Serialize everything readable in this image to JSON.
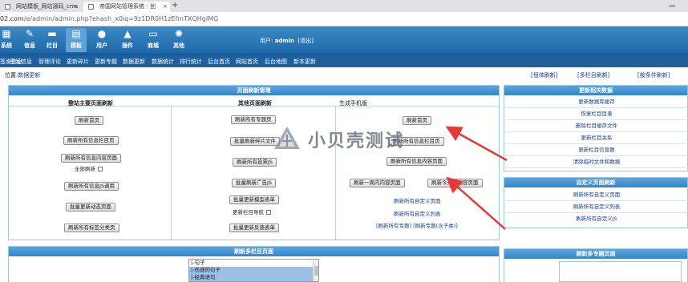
{
  "browser": {
    "tabs": [
      {
        "title": "网站模板_网站源码_cms",
        "active": false
      },
      {
        "title": "帝国网站管理系统 - 创",
        "active": true
      }
    ],
    "url_host": "02.com",
    "url_path": "/e/admin/admin.php?ehash_x0iq=9z1DR0H1zEfmTXQHgIMG"
  },
  "topnav": {
    "items": [
      {
        "label": "系统",
        "icon": "system-icon"
      },
      {
        "label": "信息",
        "icon": "info-icon"
      },
      {
        "label": "栏目",
        "icon": "folder-icon"
      },
      {
        "label": "模板",
        "icon": "template-icon",
        "active": true
      },
      {
        "label": "用户",
        "icon": "user-icon"
      },
      {
        "label": "插件",
        "icon": "plugin-icon"
      },
      {
        "label": "商城",
        "icon": "shop-icon"
      },
      {
        "label": "其他",
        "icon": "gear-icon"
      }
    ],
    "user_prefix": "用户:",
    "username": "admin",
    "logout": "[退出]"
  },
  "submenu": [
    "签发信息",
    "管理评论",
    "数据更新",
    "更新碎片",
    "更新专题",
    "数据更新",
    "数据统计",
    "排行统计",
    "后台首页",
    "网站首页",
    "后台地图",
    "新本更新"
  ],
  "location": {
    "prefix": "位置:",
    "link": "数据更新"
  },
  "toplinks": [
    "[恒体刷新]",
    "[多栏目刷新]",
    "[按条件刷新]"
  ],
  "main_panel": {
    "title": "页面刷新管理",
    "col_headers": [
      "整站主要页面刷新",
      "其他页面刷新",
      "生成手机版"
    ],
    "col1": [
      "刷新首页",
      "刷新所有信息栏目页",
      "刷新所有信息内容页面",
      "刷新所有信息JS调用",
      "批量更新动态页面",
      "刷新所有标签分类页"
    ],
    "col1_all_refresh": "全部刷新",
    "col2": [
      "刷新所有专题页",
      "批量刷新碎片文件",
      "刷新所有投票JS",
      "批量刷新广告JS",
      "批量更新模型表单",
      "批量更新反馈表单"
    ],
    "col2_nav_refresh": "更新栏目导航",
    "col3_buttons": [
      "刷新首页",
      "刷新所有信息栏目页",
      "刷新所有信息内容页面",
      "刷新一周内内容页面",
      "刷新今天内内容页面"
    ],
    "col3_links": [
      "刷新所有自定义页面",
      "刷新所有自定义列表"
    ],
    "col3_bottom": "[刷新所有专题] [刷新专题(含子类)]"
  },
  "right_panel_1": {
    "title": "更新相关数据",
    "items": [
      "更新数据库缓存",
      "恢复栏目目录",
      "删除栏目缓存文件",
      "更新栏目关系",
      "更新栏目信息数",
      "清除临时文件和数据"
    ]
  },
  "right_panel_2": {
    "title": "自定义页面刷新",
    "items": [
      "刷新所有自定义页面",
      "刷新所有自定义列表",
      "刷新所有自定义JS"
    ]
  },
  "bottom_panel": {
    "title": "刷新多栏目页面",
    "list": [
      {
        "label": "|-句子",
        "selected": false
      },
      {
        "label": "|-伤感的句子",
        "selected": true
      },
      {
        "label": "|-经典语句",
        "selected": true
      }
    ]
  },
  "bottom_right_panel": {
    "title": "刷新多专题页面"
  },
  "watermark": {
    "text": "小贝壳测试"
  },
  "colors": {
    "nav": "#2a78b9",
    "panel_head": "#3f90d2",
    "link": "#1a3b8c",
    "arrow": "#e53935"
  }
}
